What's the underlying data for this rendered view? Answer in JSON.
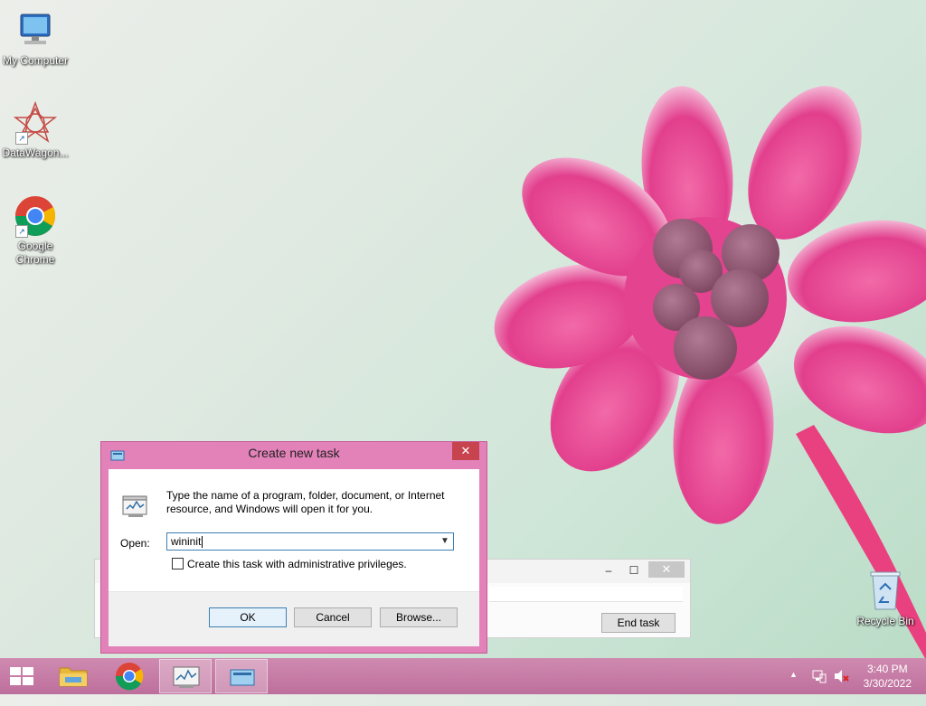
{
  "desktop": {
    "icons": [
      {
        "label": "My Computer"
      },
      {
        "label": "DataWagon..."
      },
      {
        "label_line1": "Google",
        "label_line2": "Chrome"
      },
      {
        "label": "Recycle Bin"
      }
    ]
  },
  "task_manager": {
    "end_task_label": "End task",
    "minimize_glyph": "–",
    "maximize_glyph": "☐",
    "close_glyph": "✕"
  },
  "dialog": {
    "title": "Create new task",
    "close_glyph": "✕",
    "description": "Type the name of a program, folder, document, or Internet resource, and Windows will open it for you.",
    "open_label": "Open:",
    "open_value": "wininit",
    "admin_checkbox_label": "Create this task with administrative privileges.",
    "admin_checked": false,
    "ok_label": "OK",
    "cancel_label": "Cancel",
    "browse_label": "Browse..."
  },
  "taskbar": {
    "clock_time": "3:40 PM",
    "clock_date": "3/30/2022",
    "tray_chevron": "▲"
  },
  "colors": {
    "accent": "#e381b9",
    "taskbar": "#c77aa6",
    "close_red": "#c7434e"
  }
}
